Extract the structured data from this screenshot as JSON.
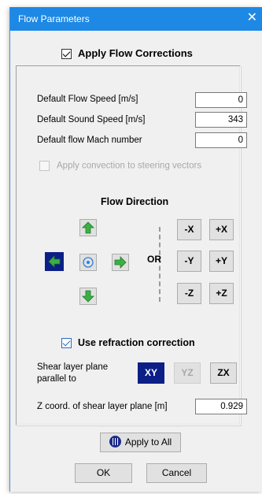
{
  "window": {
    "title": "Flow Parameters",
    "close_glyph": "✕"
  },
  "apply_corrections": {
    "label": "Apply Flow Corrections",
    "checked": true
  },
  "fields": {
    "flow_speed": {
      "label": "Default Flow Speed [m/s]",
      "value": "0"
    },
    "sound_speed": {
      "label": "Default Sound Speed [m/s]",
      "value": "343"
    },
    "mach": {
      "label": "Default flow Mach number",
      "value": "0"
    }
  },
  "convection": {
    "label": "Apply convection to steering vectors",
    "checked": false,
    "enabled": false
  },
  "flow_direction": {
    "heading": "Flow Direction",
    "or_label": "OR",
    "arrows": {
      "up_icon": "green-up-arrow-icon",
      "left_icon": "green-left-arrow-icon",
      "right_icon": "green-right-arrow-icon",
      "down_icon": "green-down-arrow-icon",
      "center_icon": "blue-target-icon",
      "selected": "left"
    },
    "axes": [
      "-X",
      "+X",
      "-Y",
      "+Y",
      "-Z",
      "+Z"
    ]
  },
  "refraction": {
    "label": "Use refraction correction",
    "checked": true
  },
  "shear_layer": {
    "label_line1": "Shear layer plane",
    "label_line2": "parallel to",
    "planes": [
      {
        "label": "XY",
        "state": "active"
      },
      {
        "label": "YZ",
        "state": "disabled"
      },
      {
        "label": "ZX",
        "state": "normal"
      }
    ],
    "z_label": "Z coord. of shear layer plane [m]",
    "z_value": "0.929"
  },
  "buttons": {
    "apply_all": "Apply to All",
    "ok": "OK",
    "cancel": "Cancel"
  },
  "colors": {
    "titlebar": "#1e88e5",
    "selected": "#0b1f87",
    "arrow_green": "#3cb043"
  }
}
